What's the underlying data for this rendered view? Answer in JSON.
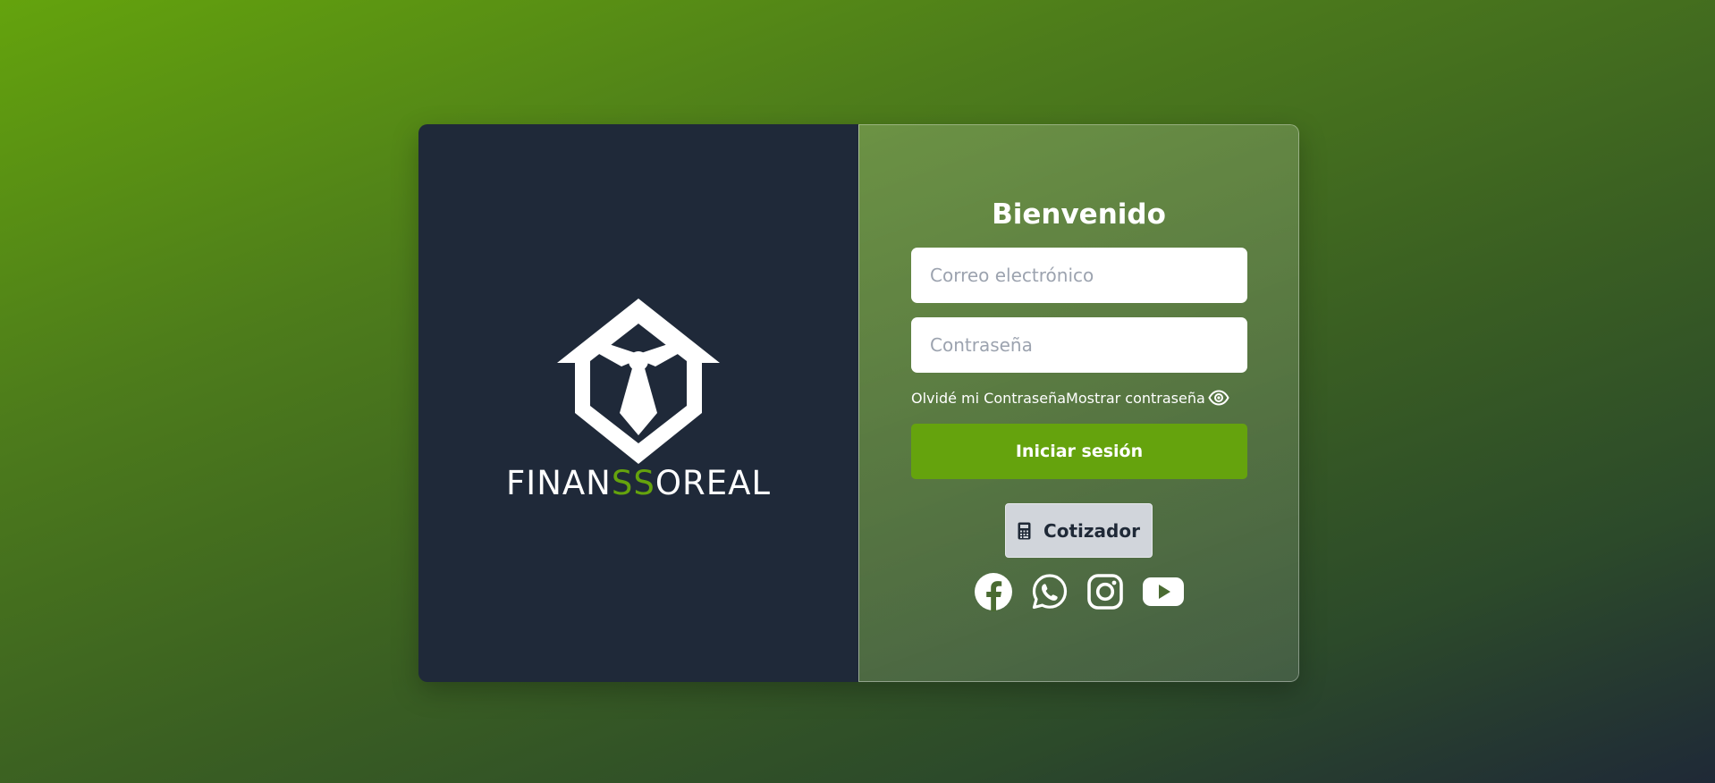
{
  "brand": {
    "name_start": "FINAN",
    "name_accent": "SS",
    "name_end": "OREAL",
    "logo_icon": "house-tie-logo",
    "accent_color": "#65a30d"
  },
  "login": {
    "title": "Bienvenido",
    "email_placeholder": "Correo electrónico",
    "password_placeholder": "Contraseña",
    "forgot_password": "Olvidé mi Contraseña",
    "show_password": "Mostrar contraseña",
    "submit_label": "Iniciar sesión"
  },
  "quoter": {
    "label": "Cotizador",
    "icon": "calculator-icon"
  },
  "socials": [
    {
      "name": "facebook-icon"
    },
    {
      "name": "whatsapp-icon"
    },
    {
      "name": "instagram-icon"
    },
    {
      "name": "youtube-icon"
    }
  ],
  "colors": {
    "panel_dark": "#1f2939",
    "primary_button": "#65a30d",
    "secondary_button": "#d1d5db"
  }
}
